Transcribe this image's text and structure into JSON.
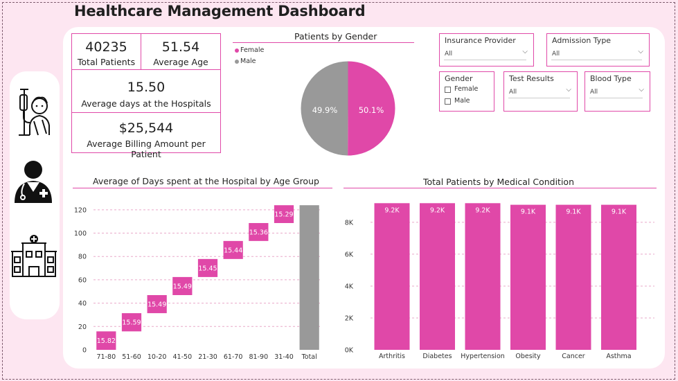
{
  "title": "Healthcare Management Dashboard",
  "colors": {
    "accent": "#e048a8",
    "gray": "#999999",
    "page_bg": "#fde6f1"
  },
  "sidebar_icons": [
    "patient-iv-icon",
    "doctor-icon",
    "hospital-icon"
  ],
  "kpis": {
    "total_patients": {
      "value": "40235",
      "label": "Total Patients"
    },
    "average_age": {
      "value": "51.54",
      "label": "Average Age"
    },
    "avg_days": {
      "value": "15.50",
      "label": "Average days at the Hospitals"
    },
    "avg_billing": {
      "value": "$25,544",
      "label": "Average Billing Amount per Patient"
    }
  },
  "slicers": {
    "insurance": {
      "title": "Insurance Provider",
      "value": "All"
    },
    "admission": {
      "title": "Admission Type",
      "value": "All"
    },
    "gender": {
      "title": "Gender",
      "options": [
        "Female",
        "Male"
      ]
    },
    "test_results": {
      "title": "Test Results",
      "value": "All"
    },
    "blood_type": {
      "title": "Blood Type",
      "value": "All"
    }
  },
  "chart_data": [
    {
      "type": "pie",
      "title": "Patients by Gender",
      "legend": "top-left",
      "slices": [
        {
          "name": "Female",
          "value": 50.1,
          "label": "50.1%",
          "color": "#e048a8"
        },
        {
          "name": "Male",
          "value": 49.9,
          "label": "49.9%",
          "color": "#999999"
        }
      ]
    },
    {
      "type": "bar",
      "subtype": "waterfall",
      "title": "Average of Days spent at the Hospital by Age Group",
      "categories": [
        "71-80",
        "51-60",
        "10-20",
        "41-50",
        "21-30",
        "61-70",
        "81-90",
        "31-40",
        "Total"
      ],
      "values": [
        15.82,
        15.59,
        15.49,
        15.49,
        15.45,
        15.44,
        15.36,
        15.29
      ],
      "labels": [
        "15.82",
        "15.59",
        "15.49",
        "15.49",
        "15.45",
        "15.44",
        "15.36",
        "15.29"
      ],
      "total": 123.93,
      "yticks": [
        0,
        20,
        40,
        60,
        80,
        100,
        120
      ],
      "ylim": [
        0,
        130
      ],
      "grid": true
    },
    {
      "type": "bar",
      "title": "Total Patients by Medical Condition",
      "categories": [
        "Arthritis",
        "Diabetes",
        "Hypertension",
        "Obesity",
        "Cancer",
        "Asthma"
      ],
      "values": [
        9200,
        9200,
        9200,
        9100,
        9100,
        9100
      ],
      "labels": [
        "9.2K",
        "9.2K",
        "9.2K",
        "9.1K",
        "9.1K",
        "9.1K"
      ],
      "yticks": [
        0,
        2000,
        4000,
        6000,
        8000
      ],
      "ytick_labels": [
        "0K",
        "2K",
        "4K",
        "6K",
        "8K"
      ],
      "ylim": [
        0,
        9300
      ],
      "grid": true
    }
  ]
}
